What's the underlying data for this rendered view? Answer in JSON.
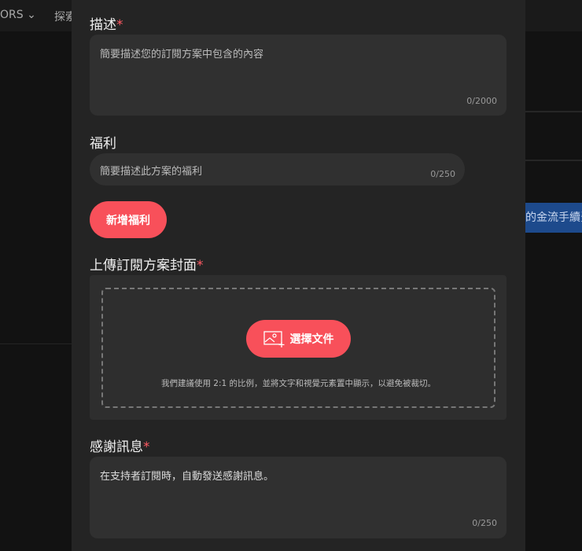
{
  "nav": {
    "item1": "ORS",
    "item2": "探索"
  },
  "banner_text": "的金流手續費",
  "description": {
    "label": "描述",
    "required": "*",
    "placeholder": "簡要描述您的訂閱方案中包含的內容",
    "counter": "0/2000"
  },
  "benefits": {
    "label": "福利",
    "placeholder": "簡要描述此方案的福利",
    "counter": "0/250",
    "add_button": "新增福利"
  },
  "cover": {
    "label": "上傳訂閱方案封面",
    "required": "*",
    "button": "選擇文件",
    "hint": "我們建議使用 2:1 的比例，並將文字和視覺元素置中顯示，以避免被裁切。"
  },
  "thanks": {
    "label": "感謝訊息",
    "required": "*",
    "value": "在支持者訂閱時，自動發送感謝訊息。",
    "counter": "0/250"
  },
  "colors": {
    "accent": "#f8505a",
    "panel": "#242424"
  }
}
